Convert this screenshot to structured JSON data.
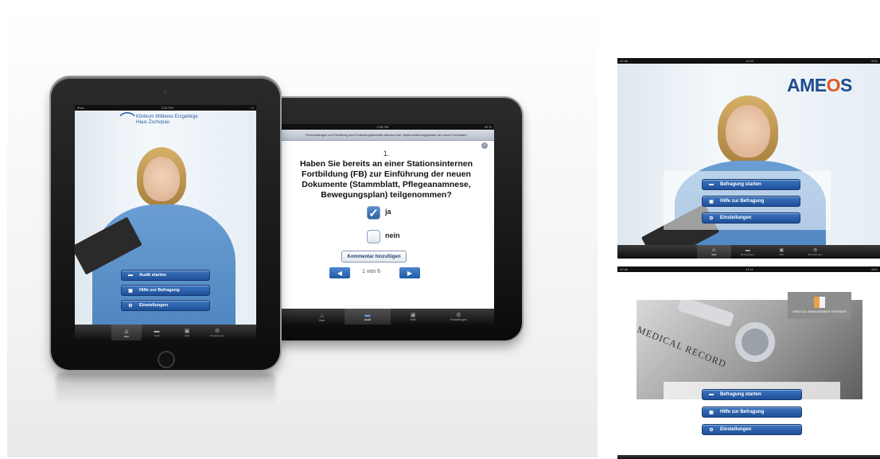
{
  "left_ipad": {
    "status": {
      "carrier": "iPad",
      "time": "3:20 PM"
    },
    "logo": {
      "line1": "Klinikum Mittleres Erzgebirge",
      "line2": "Haus Zschopau"
    },
    "menu": [
      {
        "label": "Audit starten",
        "icon": "chat-icon"
      },
      {
        "label": "Hilfe zur Befragung",
        "icon": "medkit-icon"
      },
      {
        "label": "Einstellungen",
        "icon": "gear-icon"
      }
    ],
    "tabs": [
      "Start",
      "Audit",
      "Hilfe",
      "Einstellungen"
    ]
  },
  "landscape_ipad": {
    "status": {
      "time": "2:36 PM",
      "battery": "99 %"
    },
    "header": "Personalfragen zur Ermittlung des Fortbildungsbedarfs während der Implementierungsphase der neuen Formulare",
    "question_number": "1.",
    "question": "Haben Sie bereits an einer Stationsinternen Fortbildung (FB) zur Einführung der neuen Dokumente (Stammblatt, Pflegeanamnese, Bewegungsplan) teilgenommen?",
    "options": [
      {
        "label": "ja",
        "checked": true
      },
      {
        "label": "nein",
        "checked": false
      }
    ],
    "comment_button": "Kommentar hinzufügen",
    "pager": "1 von 6",
    "tabs": [
      "Start",
      "Audit",
      "Hilfe",
      "Einstellungen"
    ]
  },
  "ameos_shot": {
    "status": {
      "carrier": "o2-de",
      "time": "14:33",
      "battery": "92%"
    },
    "brand": {
      "pre": "AME",
      "o": "O",
      "post": "S"
    },
    "menu": [
      {
        "label": "Befragung starten",
        "icon": "chat-icon"
      },
      {
        "label": "Hilfe zur Befragung",
        "icon": "medkit-icon"
      },
      {
        "label": "Einstellungen",
        "icon": "gear-icon"
      }
    ],
    "tabs": [
      "Start",
      "Befragungen",
      "Hilfe",
      "Einstellungen"
    ]
  },
  "mmp_shot": {
    "status": {
      "carrier": "o2-de",
      "time": "11:11",
      "battery": "34%"
    },
    "brand": "MEDICAL MANAGEMENT PARTNER",
    "record_text": "MEDICAL RECORD",
    "menu": [
      {
        "label": "Befragung starten",
        "icon": "chat-icon"
      },
      {
        "label": "Hilfe zur Befragung",
        "icon": "medkit-icon"
      },
      {
        "label": "Einstellungen",
        "icon": "gear-icon"
      }
    ]
  },
  "colors": {
    "accent_blue": "#2a5ba8",
    "ameos_orange": "#e45a1e"
  }
}
